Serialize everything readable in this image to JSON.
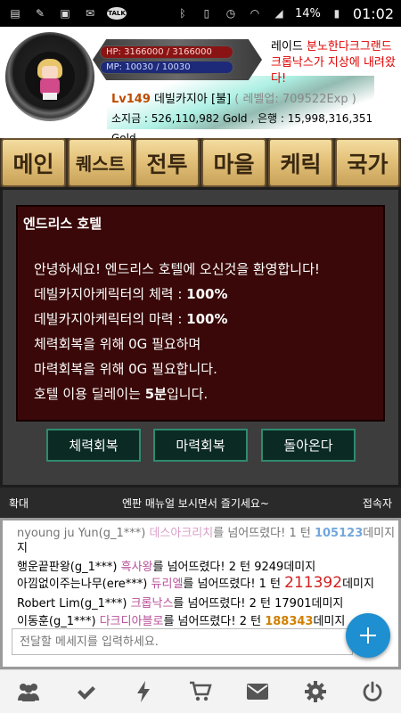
{
  "statusbar": {
    "battery": "14%",
    "time": "01:02",
    "talk_label": "TALK"
  },
  "player": {
    "hp": "HP: 3166000 / 3166000",
    "mp": "MP: 10030 / 10030",
    "level": "Lv149",
    "name": "데빌카지아",
    "element": "[불]",
    "exp": "( 레벨업: 709522Exp )",
    "gold_line": "소지금 : 526,110,982 Gold , 은행 : 15,998,316,351 Gold"
  },
  "raid": {
    "prefix": "레이드 ",
    "highlight": "분노한다크그랜드 크롭낙스가 지상에 내려왔다!"
  },
  "menu": [
    "메인",
    "퀘스트",
    "전투",
    "마을",
    "케릭",
    "국가"
  ],
  "hotel": {
    "title": "엔드리스 호텔",
    "welcome": "안녕하세요! 엔드리스 호텔에 오신것을 환영합니다!",
    "hp_text": "데빌카지아케릭터의 체력 : ",
    "hp_val": "100%",
    "mp_text": "데빌카지아케릭터의 마력 : ",
    "mp_val": "100%",
    "hp_cost": "체력회복을 위해 0G 필요하며",
    "mp_cost": "마력회복을 위해 0G 필요합니다.",
    "delay_text": "호텔 이용 딜레이는 ",
    "delay_val": "5분",
    "delay_end": "입니다.",
    "buttons": [
      "체력회복",
      "마력회복",
      "돌아온다"
    ]
  },
  "chatbar": {
    "left": "확대",
    "center": "엔판 매뉴얼 보시면서 즐기세요~",
    "right": "접속자"
  },
  "chat": [
    {
      "user": "nyoung ju Yun(g_1***)",
      "target": "데스아크리치",
      "mid": "를 넘어뜨렸다! 1 턴 ",
      "dmg": "105123",
      "end": "데미지"
    },
    {
      "user": "지",
      "target": "",
      "mid": "",
      "dmg": "",
      "end": ""
    },
    {
      "user": "행운끝판왕(g_1***)",
      "target": "흑사왕",
      "mid": "를 넘어뜨렸다! 2 턴 ",
      "dmg": "9249",
      "end": "데미지"
    },
    {
      "user": "아낌없이주는나무(ere***)",
      "target": "듀리엘",
      "mid": "를 넘어뜨렸다! 1 턴 ",
      "dmg": "211392",
      "end": "데미지"
    },
    {
      "user": "Robert Lim(g_1***)",
      "target": "크롭낙스",
      "mid": "를 넘어뜨렸다! 2 턴 ",
      "dmg": "17901",
      "end": "데미지"
    },
    {
      "user": "이동훈(g_1***)",
      "target": "다크디아블로",
      "mid": "를 넘어뜨렸다! 2 턴 ",
      "dmg": "188343",
      "end": "데미지"
    }
  ],
  "input_placeholder": "전달할 메세지를 입력하세요.",
  "nav_icons": [
    "users-icon",
    "check-icon",
    "bolt-icon",
    "cart-icon",
    "mail-icon",
    "gear-icon",
    "power-icon"
  ]
}
